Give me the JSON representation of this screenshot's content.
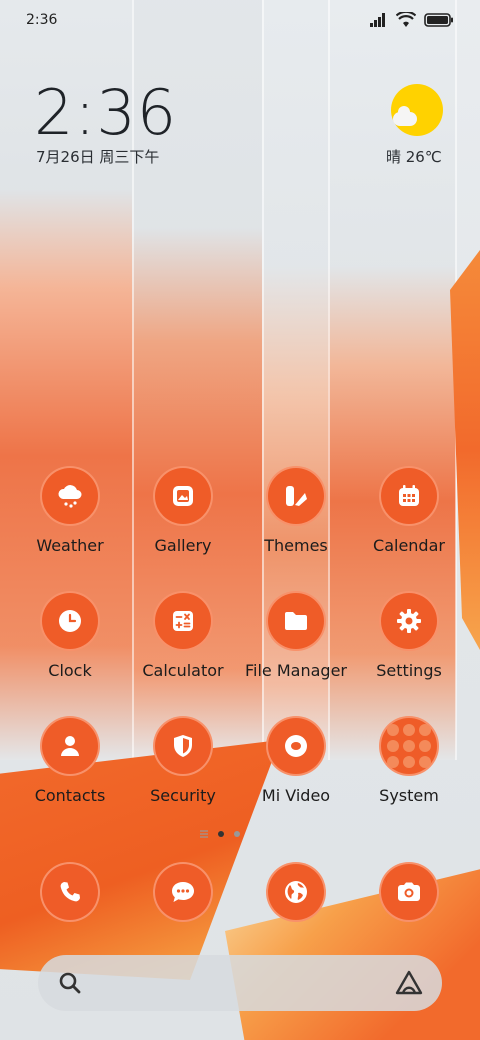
{
  "status_bar": {
    "time": "2:36"
  },
  "widget": {
    "time": "2:36",
    "date": "7月26日 周三下午",
    "weather": "晴 26℃"
  },
  "apps": [
    {
      "label": "Weather",
      "icon": "cloud-snow-icon"
    },
    {
      "label": "Gallery",
      "icon": "image-icon"
    },
    {
      "label": "Themes",
      "icon": "themes-icon"
    },
    {
      "label": "Calendar",
      "icon": "calendar-icon"
    },
    {
      "label": "Clock",
      "icon": "clock-icon"
    },
    {
      "label": "Calculator",
      "icon": "calculator-icon"
    },
    {
      "label": "File Manager",
      "icon": "folder-icon"
    },
    {
      "label": "Settings",
      "icon": "gear-icon"
    },
    {
      "label": "Contacts",
      "icon": "person-icon"
    },
    {
      "label": "Security",
      "icon": "shield-icon"
    },
    {
      "label": "Mi Video",
      "icon": "video-icon"
    },
    {
      "label": "System",
      "icon": "folder-grid-icon"
    }
  ],
  "dock": [
    {
      "icon": "phone-icon"
    },
    {
      "icon": "message-icon"
    },
    {
      "icon": "browser-icon"
    },
    {
      "icon": "camera-icon"
    }
  ],
  "colors": {
    "accent": "#ef5c28",
    "sun": "#ffd200"
  }
}
